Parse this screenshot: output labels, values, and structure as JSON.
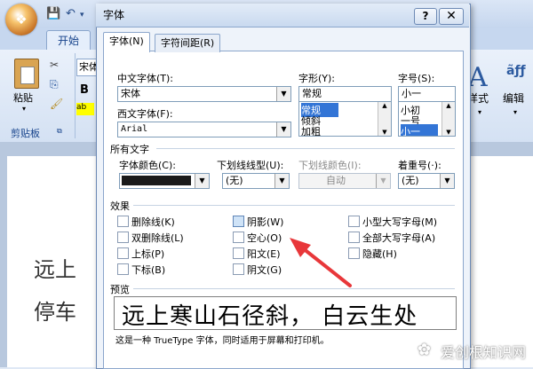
{
  "dialog": {
    "title": "字体",
    "help": "?",
    "close": "✕",
    "tabs": [
      "字体(N)",
      "字符间距(R)"
    ]
  },
  "font": {
    "chinese_label": "中文字体(T):",
    "chinese_value": "宋体",
    "western_label": "西文字体(F):",
    "western_value": "Arial",
    "style_label": "字形(Y):",
    "style_value": "常规",
    "style_list": [
      "常规",
      "倾斜",
      "加粗"
    ],
    "size_label": "字号(S):",
    "size_value": "小一",
    "size_list": [
      "小初",
      "一号",
      "小一"
    ]
  },
  "all_text": {
    "section": "所有文字",
    "color_label": "字体颜色(C):",
    "underline_label": "下划线线型(U):",
    "underline_value": "(无)",
    "underline_color_label": "下划线颜色(I):",
    "underline_color_value": "自动",
    "emphasis_label": "着重号(·):",
    "emphasis_value": "(无)"
  },
  "effects": {
    "section": "效果",
    "col1": [
      "删除线(K)",
      "双删除线(L)",
      "上标(P)",
      "下标(B)"
    ],
    "col2": [
      "阴影(W)",
      "空心(O)",
      "阳文(E)",
      "阴文(G)"
    ],
    "col3": [
      "小型大写字母(M)",
      "全部大写字母(A)",
      "隐藏(H)"
    ]
  },
  "preview": {
    "section": "预览",
    "sample": "远上寒山石径斜， 白云生处",
    "note": "这是一种 TrueType 字体，同时适用于屏幕和打印机。"
  },
  "word": {
    "tab_start": "开始",
    "paste": "粘贴",
    "clipboard": "剪贴板",
    "font_box": "宋体",
    "bold": "B",
    "style": "样式",
    "edit": "编辑",
    "doc_lines": [
      "远上",
      "停车"
    ]
  },
  "watermark": "爱创根知识网",
  "colors": {
    "accent": "#3375d6",
    "arrow": "#e8373a",
    "font_color_swatch": "#1a1a1a"
  }
}
